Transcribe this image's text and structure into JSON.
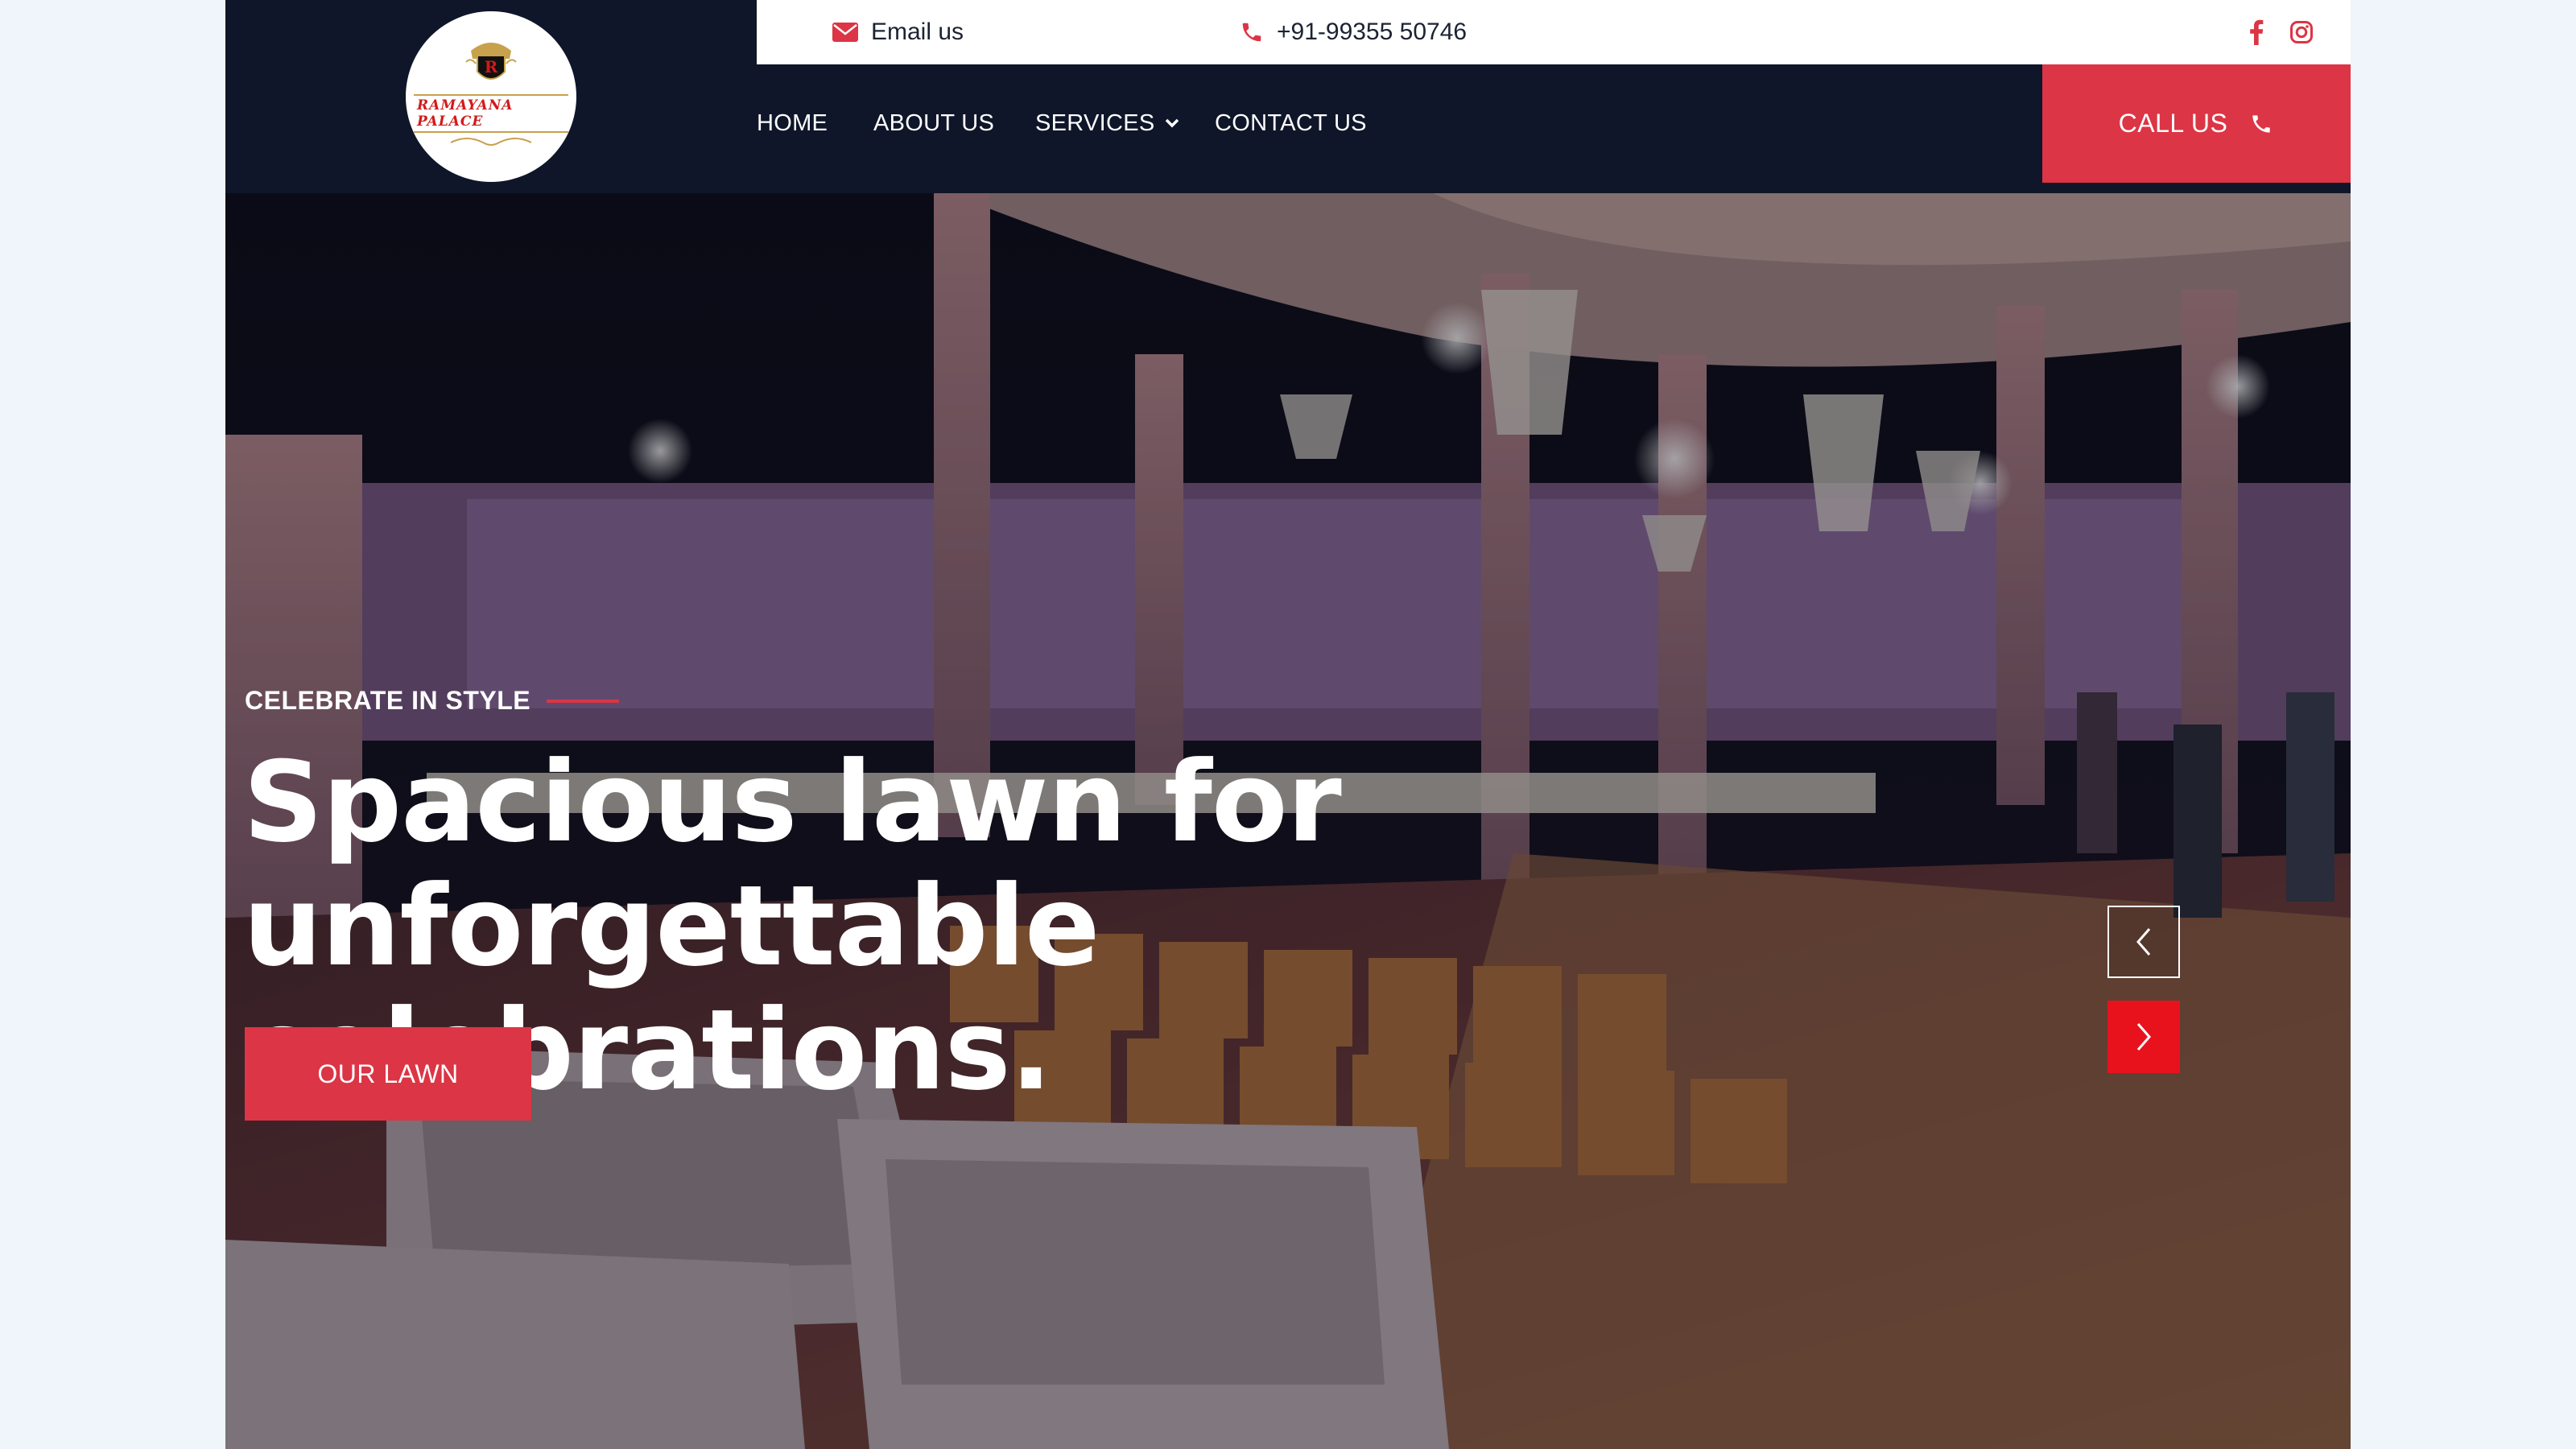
{
  "brand": {
    "logo_text": "RAMAYANA PALACE",
    "logo_mark": "R",
    "accent_color": "#dc3545",
    "dark_color": "#0f1629"
  },
  "topbar": {
    "email_label": "Email us",
    "email_icon": "envelope-icon",
    "phone_label": "+91-99355 50746",
    "phone_icon": "phone-icon",
    "social": [
      "facebook-icon",
      "instagram-icon"
    ]
  },
  "nav": {
    "items": [
      {
        "label": "HOME"
      },
      {
        "label": "ABOUT US"
      },
      {
        "label": "SERVICES",
        "has_dropdown": true
      },
      {
        "label": "CONTACT US"
      }
    ],
    "call_label": "CALL US"
  },
  "hero": {
    "eyebrow": "CELEBRATE IN STYLE",
    "headline_line1": "Spacious lawn for unforgettable",
    "headline_line2": "celebrations.",
    "cta_label": "OUR LAWN",
    "prev_icon": "chevron-left-icon",
    "next_icon": "chevron-right-icon",
    "next_color": "#e8121d"
  }
}
